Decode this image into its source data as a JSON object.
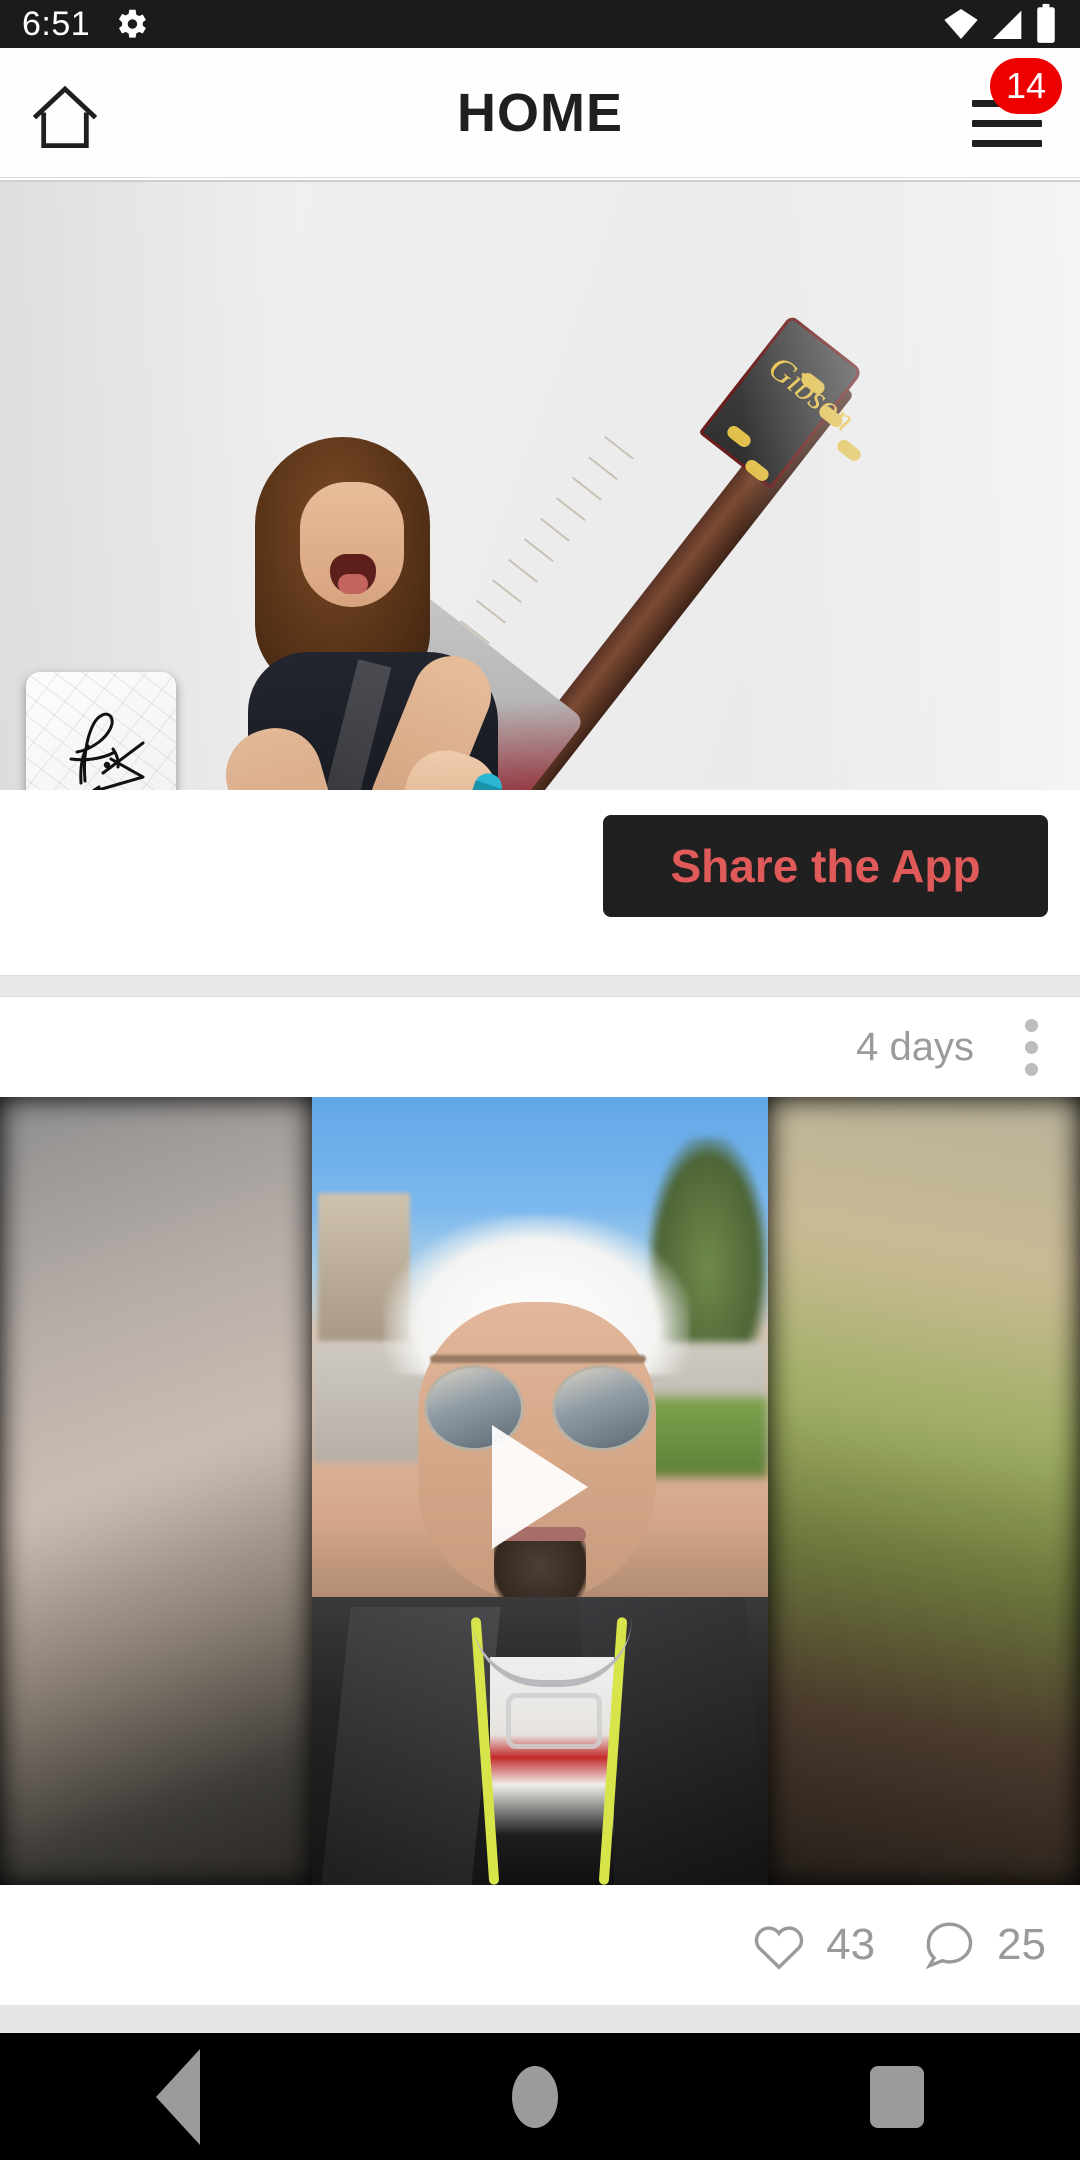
{
  "status_bar": {
    "time": "6:51",
    "icons": [
      "gear-icon",
      "wifi-icon",
      "cellular-signal-icon",
      "battery-icon"
    ]
  },
  "app_bar": {
    "title": "HOME",
    "home_icon": "home-icon",
    "menu_icon": "hamburger-menu-icon",
    "notification_badge": "14"
  },
  "hero": {
    "alt": "guitarist-banner-image",
    "brand_on_headstock": "Gibson"
  },
  "avatar": {
    "alt": "artist-signature-avatar"
  },
  "share": {
    "label": "Share the App"
  },
  "post": {
    "age": "4 days",
    "overflow_icon": "kebab-menu-icon",
    "media_type": "video",
    "play_icon": "play-icon",
    "like_icon": "heart-icon",
    "like_count": "43",
    "comment_icon": "comment-bubble-icon",
    "comment_count": "25"
  },
  "nav_bar": {
    "back": "back-triangle-icon",
    "home": "home-circle-icon",
    "recents": "recents-square-icon"
  },
  "colors": {
    "badge_red": "#ee0000",
    "share_bg": "#202020",
    "share_text": "#e15a5a",
    "status_bg": "#1b1b1b",
    "nav_bg": "#000000",
    "muted_text": "#9b9b9b"
  }
}
